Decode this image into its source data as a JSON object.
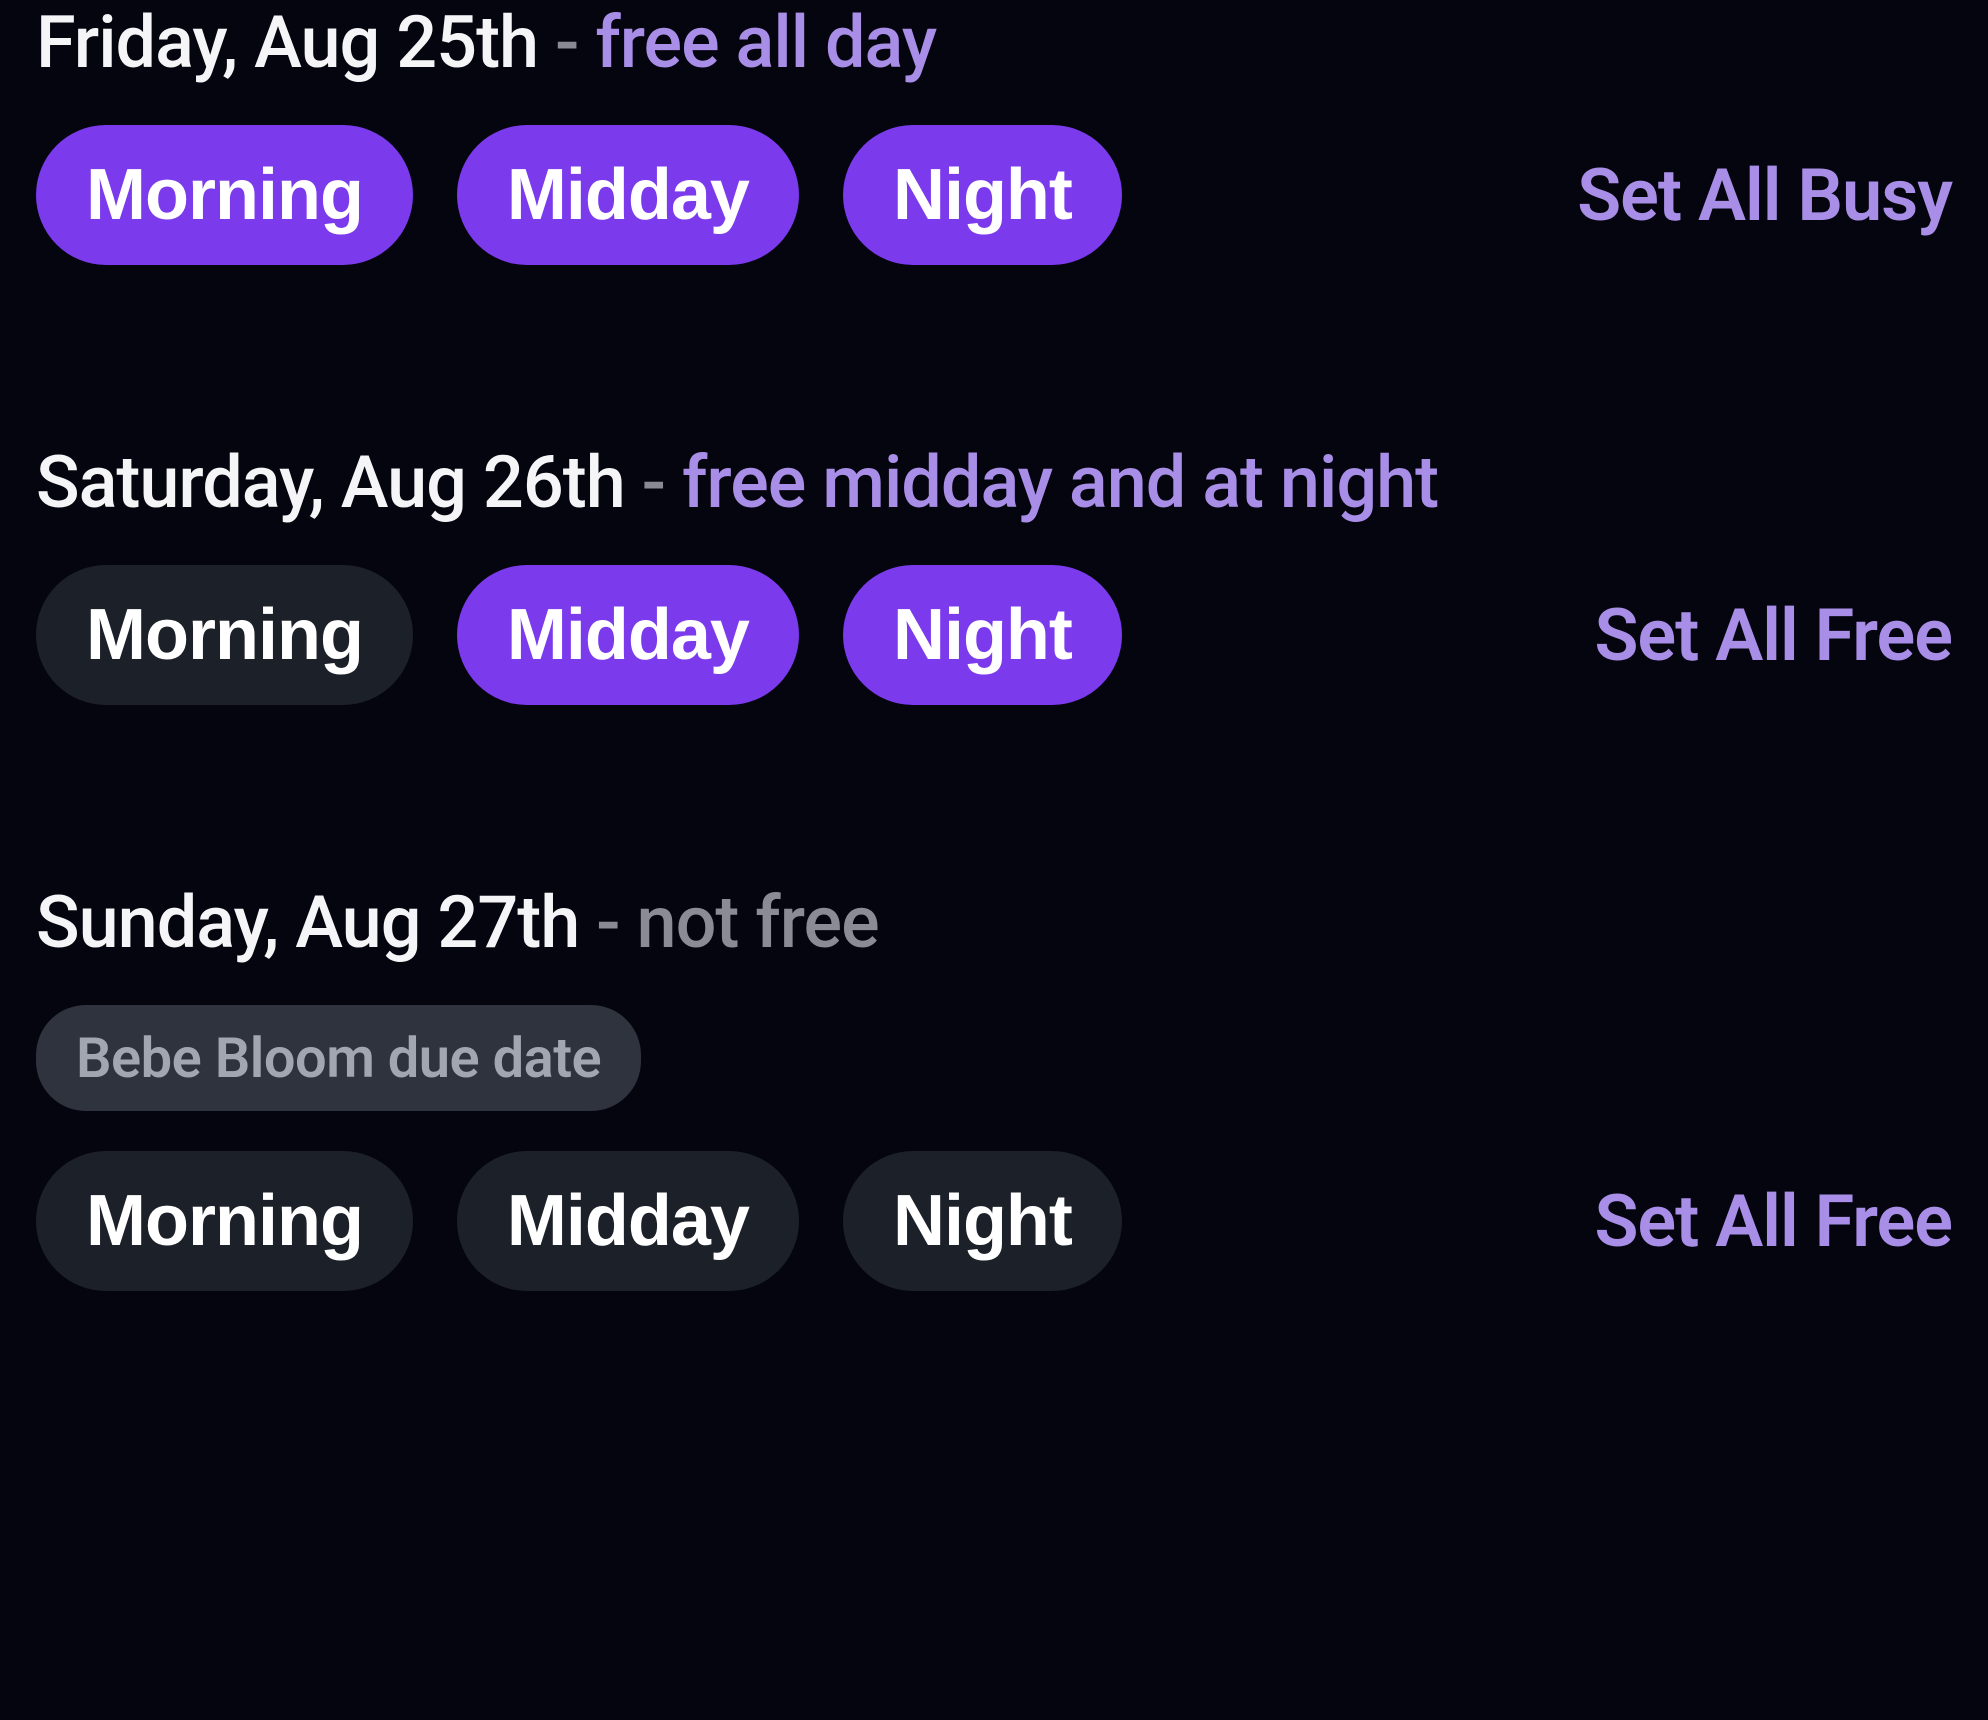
{
  "colors": {
    "background": "#050510",
    "accent": "#7c3aed",
    "accentText": "#a98ee8",
    "inactiveSlot": "#1c2029",
    "muted": "#8b8b96",
    "chipBg": "#2f333d",
    "chipText": "#a2a6b0"
  },
  "days": [
    {
      "date": "Friday, Aug 25th",
      "separator": " - ",
      "status": "free all day",
      "statusKind": "free",
      "events": [],
      "slots": [
        {
          "label": "Morning",
          "state": "free"
        },
        {
          "label": "Midday",
          "state": "free"
        },
        {
          "label": "Night",
          "state": "free"
        }
      ],
      "toggleLabel": "Set All Busy"
    },
    {
      "date": "Saturday, Aug 26th",
      "separator": " - ",
      "status": "free midday and at night",
      "statusKind": "free",
      "events": [],
      "slots": [
        {
          "label": "Morning",
          "state": "busy"
        },
        {
          "label": "Midday",
          "state": "free"
        },
        {
          "label": "Night",
          "state": "free"
        }
      ],
      "toggleLabel": "Set All Free"
    },
    {
      "date": "Sunday, Aug 27th",
      "separator": " - ",
      "status": "not free",
      "statusKind": "notfree",
      "events": [
        {
          "title": "Bebe Bloom due date"
        }
      ],
      "slots": [
        {
          "label": "Morning",
          "state": "busy"
        },
        {
          "label": "Midday",
          "state": "busy"
        },
        {
          "label": "Night",
          "state": "busy"
        }
      ],
      "toggleLabel": "Set All Free"
    }
  ]
}
